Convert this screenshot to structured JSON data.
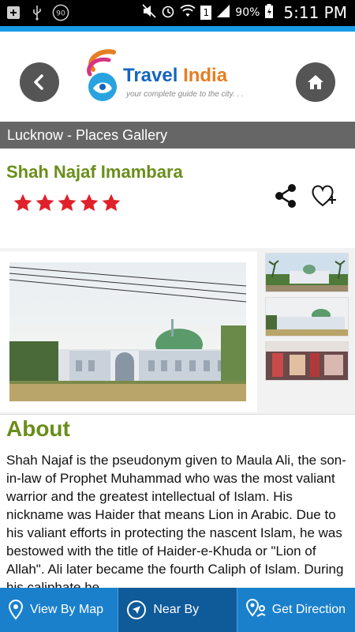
{
  "status_bar": {
    "battery": "90%",
    "time": "5:11 PM",
    "notification_badge": "90",
    "sim_indicator": "1"
  },
  "header": {
    "logo_title_part1": "Travel ",
    "logo_title_part2": "India",
    "logo_tagline": "your complete guide to the city. . ."
  },
  "section": {
    "title": "Lucknow - Places Gallery"
  },
  "place": {
    "name": "Shah Najaf Imambara",
    "rating": 5
  },
  "about": {
    "heading": "About",
    "text": "Shah Najaf is the pseudonym given to Maula Ali, the son-in-law of Prophet Muhammad who was the most valiant warrior and the greatest intellectual of Islam. His nickname was Haider that means Lion in Arabic. Due to his valiant efforts in protecting the nascent Islam, he was bestowed with the title of Haider-e-Khuda or \"Lion of Allah\". Ali later became the fourth Caliph of Islam. During his caliphate he"
  },
  "bottom_nav": {
    "view_by_map": "View By Map",
    "near_by": "Near By",
    "get_direction": "Get Direction"
  },
  "colors": {
    "accent_blue": "#1a80cc",
    "title_green": "#6a8e1a",
    "star_red": "#e0202a"
  }
}
